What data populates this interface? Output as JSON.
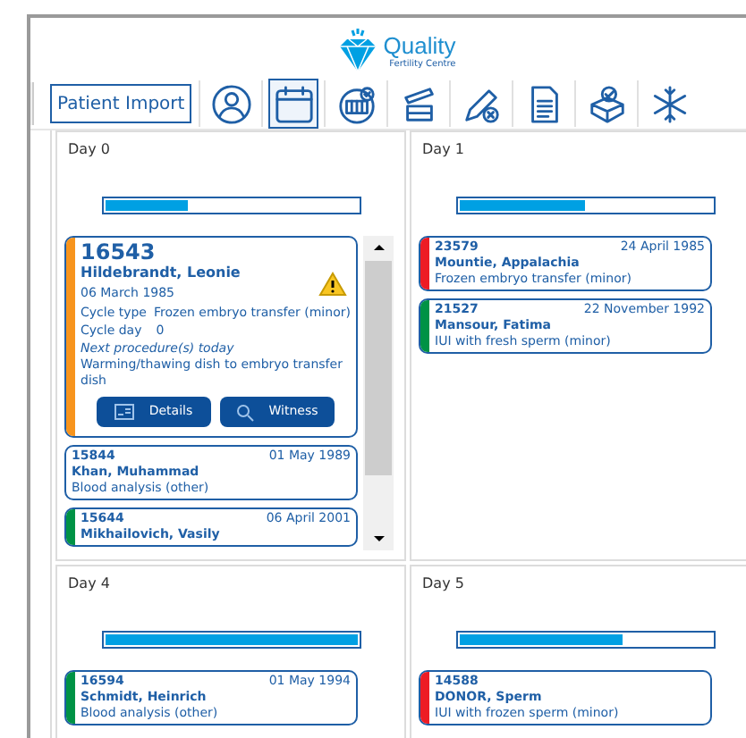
{
  "logo": {
    "name": "Quality",
    "subtitle": "Fertility Centre"
  },
  "toolbar": {
    "import_button": "Patient Import",
    "tools": [
      {
        "kind": "user",
        "selected": false
      },
      {
        "kind": "calendar",
        "selected": true
      },
      {
        "kind": "device",
        "selected": false
      },
      {
        "kind": "jar",
        "selected": false
      },
      {
        "kind": "pen",
        "selected": false
      },
      {
        "kind": "document",
        "selected": false
      },
      {
        "kind": "box",
        "selected": false
      },
      {
        "kind": "snowflake",
        "selected": false
      }
    ]
  },
  "days": [
    {
      "title": "Day 0",
      "level": 0.33,
      "scrollable": true,
      "cards": [
        {
          "id": "16543",
          "name": "Hildebrandt, Leonie",
          "dob": "06 March 1985",
          "expanded": true,
          "warning": true,
          "color": "#f7941d",
          "cycle_type_label": "Cycle type",
          "cycle_type": "Frozen embryo transfer (minor)",
          "cycle_day_label": "Cycle day",
          "cycle_day": "0",
          "next_label": "Next procedure(s) today",
          "next": "Warming/thawing dish to embryo transfer dish",
          "buttons": [
            "Details",
            "Witness"
          ]
        },
        {
          "id": "15844",
          "name": "Khan, Muhammad",
          "dob": "01 May 1989",
          "expanded": false,
          "procedure": "Blood analysis (other)"
        },
        {
          "id": "15644",
          "name": "Mikhailovich, Vasily",
          "dob": "06 April 2001",
          "expanded": false,
          "color": "#009245"
        }
      ]
    },
    {
      "title": "Day 1",
      "level": 0.5,
      "scrollable": false,
      "cards": [
        {
          "id": "23579",
          "name": "Mountie, Appalachia",
          "dob": "24 April 1985",
          "expanded": false,
          "color": "#ed1c24",
          "procedure": "Frozen embryo transfer (minor)"
        },
        {
          "id": "21527",
          "name": "Mansour, Fatima",
          "dob": "22 November 1992",
          "expanded": false,
          "color": "#009245",
          "procedure": "IUI with fresh sperm (minor)"
        }
      ]
    },
    {
      "title": "Day 4",
      "level": 1.0,
      "scrollable": false,
      "cards": [
        {
          "id": "16594",
          "name": "Schmidt, Heinrich",
          "dob": "01 May 1994",
          "expanded": false,
          "color": "#009245",
          "procedure": "Blood analysis (other)"
        }
      ]
    },
    {
      "title": "Day 5",
      "level": 0.65,
      "scrollable": false,
      "cards": [
        {
          "id": "14588",
          "name": "DONOR, Sperm",
          "expanded": false,
          "color": "#ed1c24",
          "procedure": "IUI with frozen sperm (minor)"
        }
      ]
    }
  ]
}
